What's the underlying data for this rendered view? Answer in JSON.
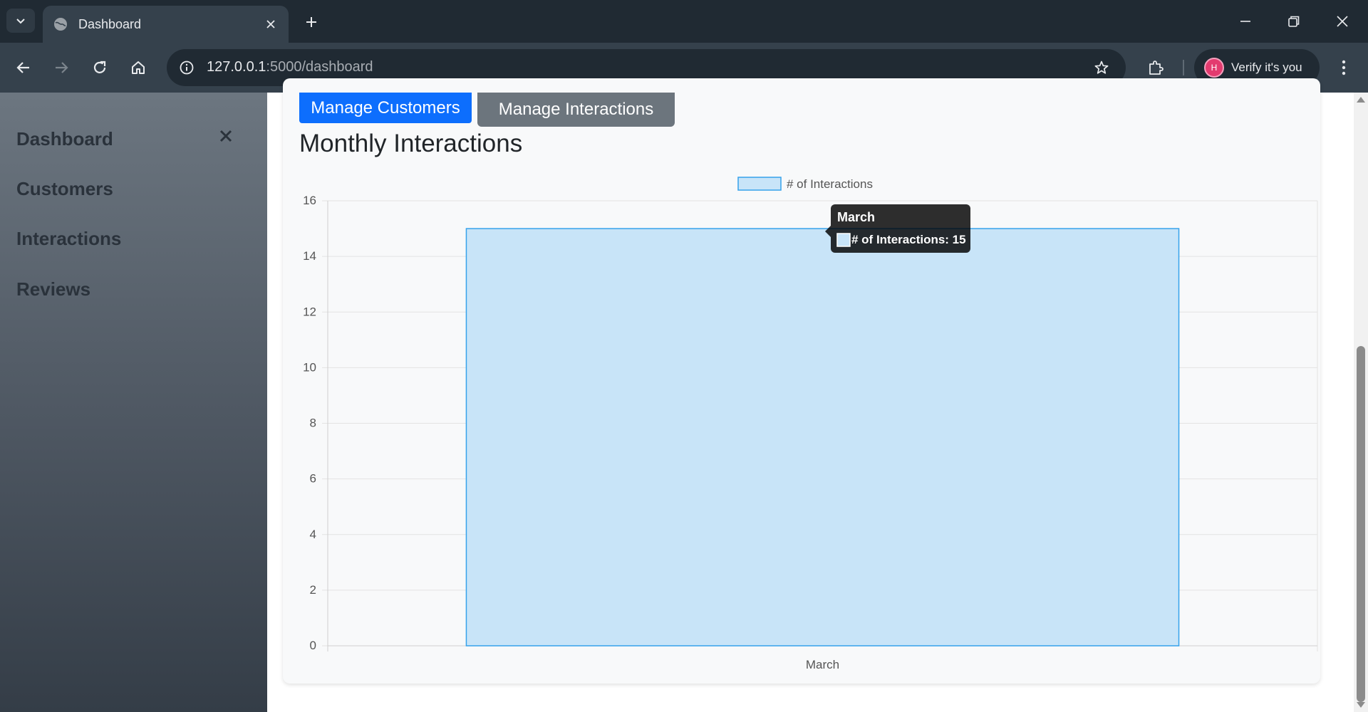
{
  "browser": {
    "tab_title": "Dashboard",
    "url_host": "127.0.0.1",
    "url_rest": ":5000/dashboard",
    "profile_label": "Verify it's you",
    "profile_initial": "H"
  },
  "sidebar": {
    "items": [
      {
        "label": "Dashboard"
      },
      {
        "label": "Customers"
      },
      {
        "label": "Interactions"
      },
      {
        "label": "Reviews"
      }
    ]
  },
  "main": {
    "manage_customers_label": "Manage Customers",
    "manage_interactions_label": "Manage Interactions",
    "section_title": "Monthly Interactions"
  },
  "colors": {
    "bar_fill": "#c8e4f8",
    "bar_stroke": "#36a2eb",
    "primary": "#0d6efd",
    "secondary": "#6c757d"
  },
  "chart_data": {
    "type": "bar",
    "categories": [
      "March"
    ],
    "series": [
      {
        "name": "# of Interactions",
        "values": [
          15
        ]
      }
    ],
    "ylim": [
      0,
      16
    ],
    "yticks": [
      0,
      2,
      4,
      6,
      8,
      10,
      12,
      14,
      16
    ],
    "grid": true,
    "legend_position": "top",
    "tooltip": {
      "title": "March",
      "label": "# of Interactions: 15"
    }
  }
}
